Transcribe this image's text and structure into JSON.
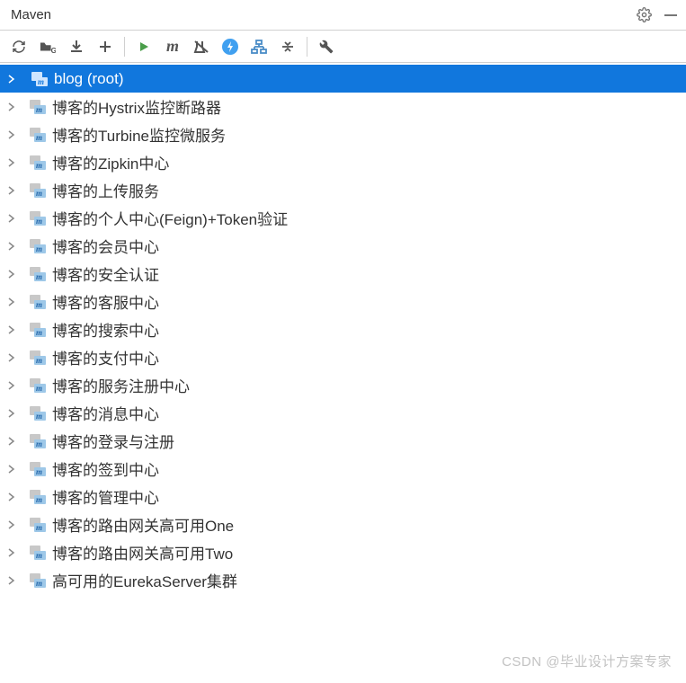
{
  "header": {
    "title": "Maven",
    "gear_icon": "gear-icon",
    "minimize_icon": "minimize-icon"
  },
  "toolbar": {
    "refresh": "refresh",
    "generate_sources": "generate-sources",
    "download": "download",
    "add": "add",
    "run": "run",
    "execute_m": "m",
    "skip_tests": "skip-tests",
    "offline": "offline",
    "show_deps": "show-deps",
    "collapse": "collapse",
    "settings": "settings"
  },
  "tree": {
    "items": [
      {
        "label": "blog (root)",
        "selected": true
      },
      {
        "label": "博客的Hystrix监控断路器",
        "selected": false
      },
      {
        "label": "博客的Turbine监控微服务",
        "selected": false
      },
      {
        "label": "博客的Zipkin中心",
        "selected": false
      },
      {
        "label": "博客的上传服务",
        "selected": false
      },
      {
        "label": "博客的个人中心(Feign)+Token验证",
        "selected": false
      },
      {
        "label": "博客的会员中心",
        "selected": false
      },
      {
        "label": "博客的安全认证",
        "selected": false
      },
      {
        "label": "博客的客服中心",
        "selected": false
      },
      {
        "label": "博客的搜索中心",
        "selected": false
      },
      {
        "label": "博客的支付中心",
        "selected": false
      },
      {
        "label": "博客的服务注册中心",
        "selected": false
      },
      {
        "label": "博客的消息中心",
        "selected": false
      },
      {
        "label": "博客的登录与注册",
        "selected": false
      },
      {
        "label": "博客的签到中心",
        "selected": false
      },
      {
        "label": "博客的管理中心",
        "selected": false
      },
      {
        "label": "博客的路由网关高可用One",
        "selected": false
      },
      {
        "label": "博客的路由网关高可用Two",
        "selected": false
      },
      {
        "label": "高可用的EurekaServer集群",
        "selected": false
      }
    ]
  },
  "watermark": "CSDN @毕业设计方案专家"
}
